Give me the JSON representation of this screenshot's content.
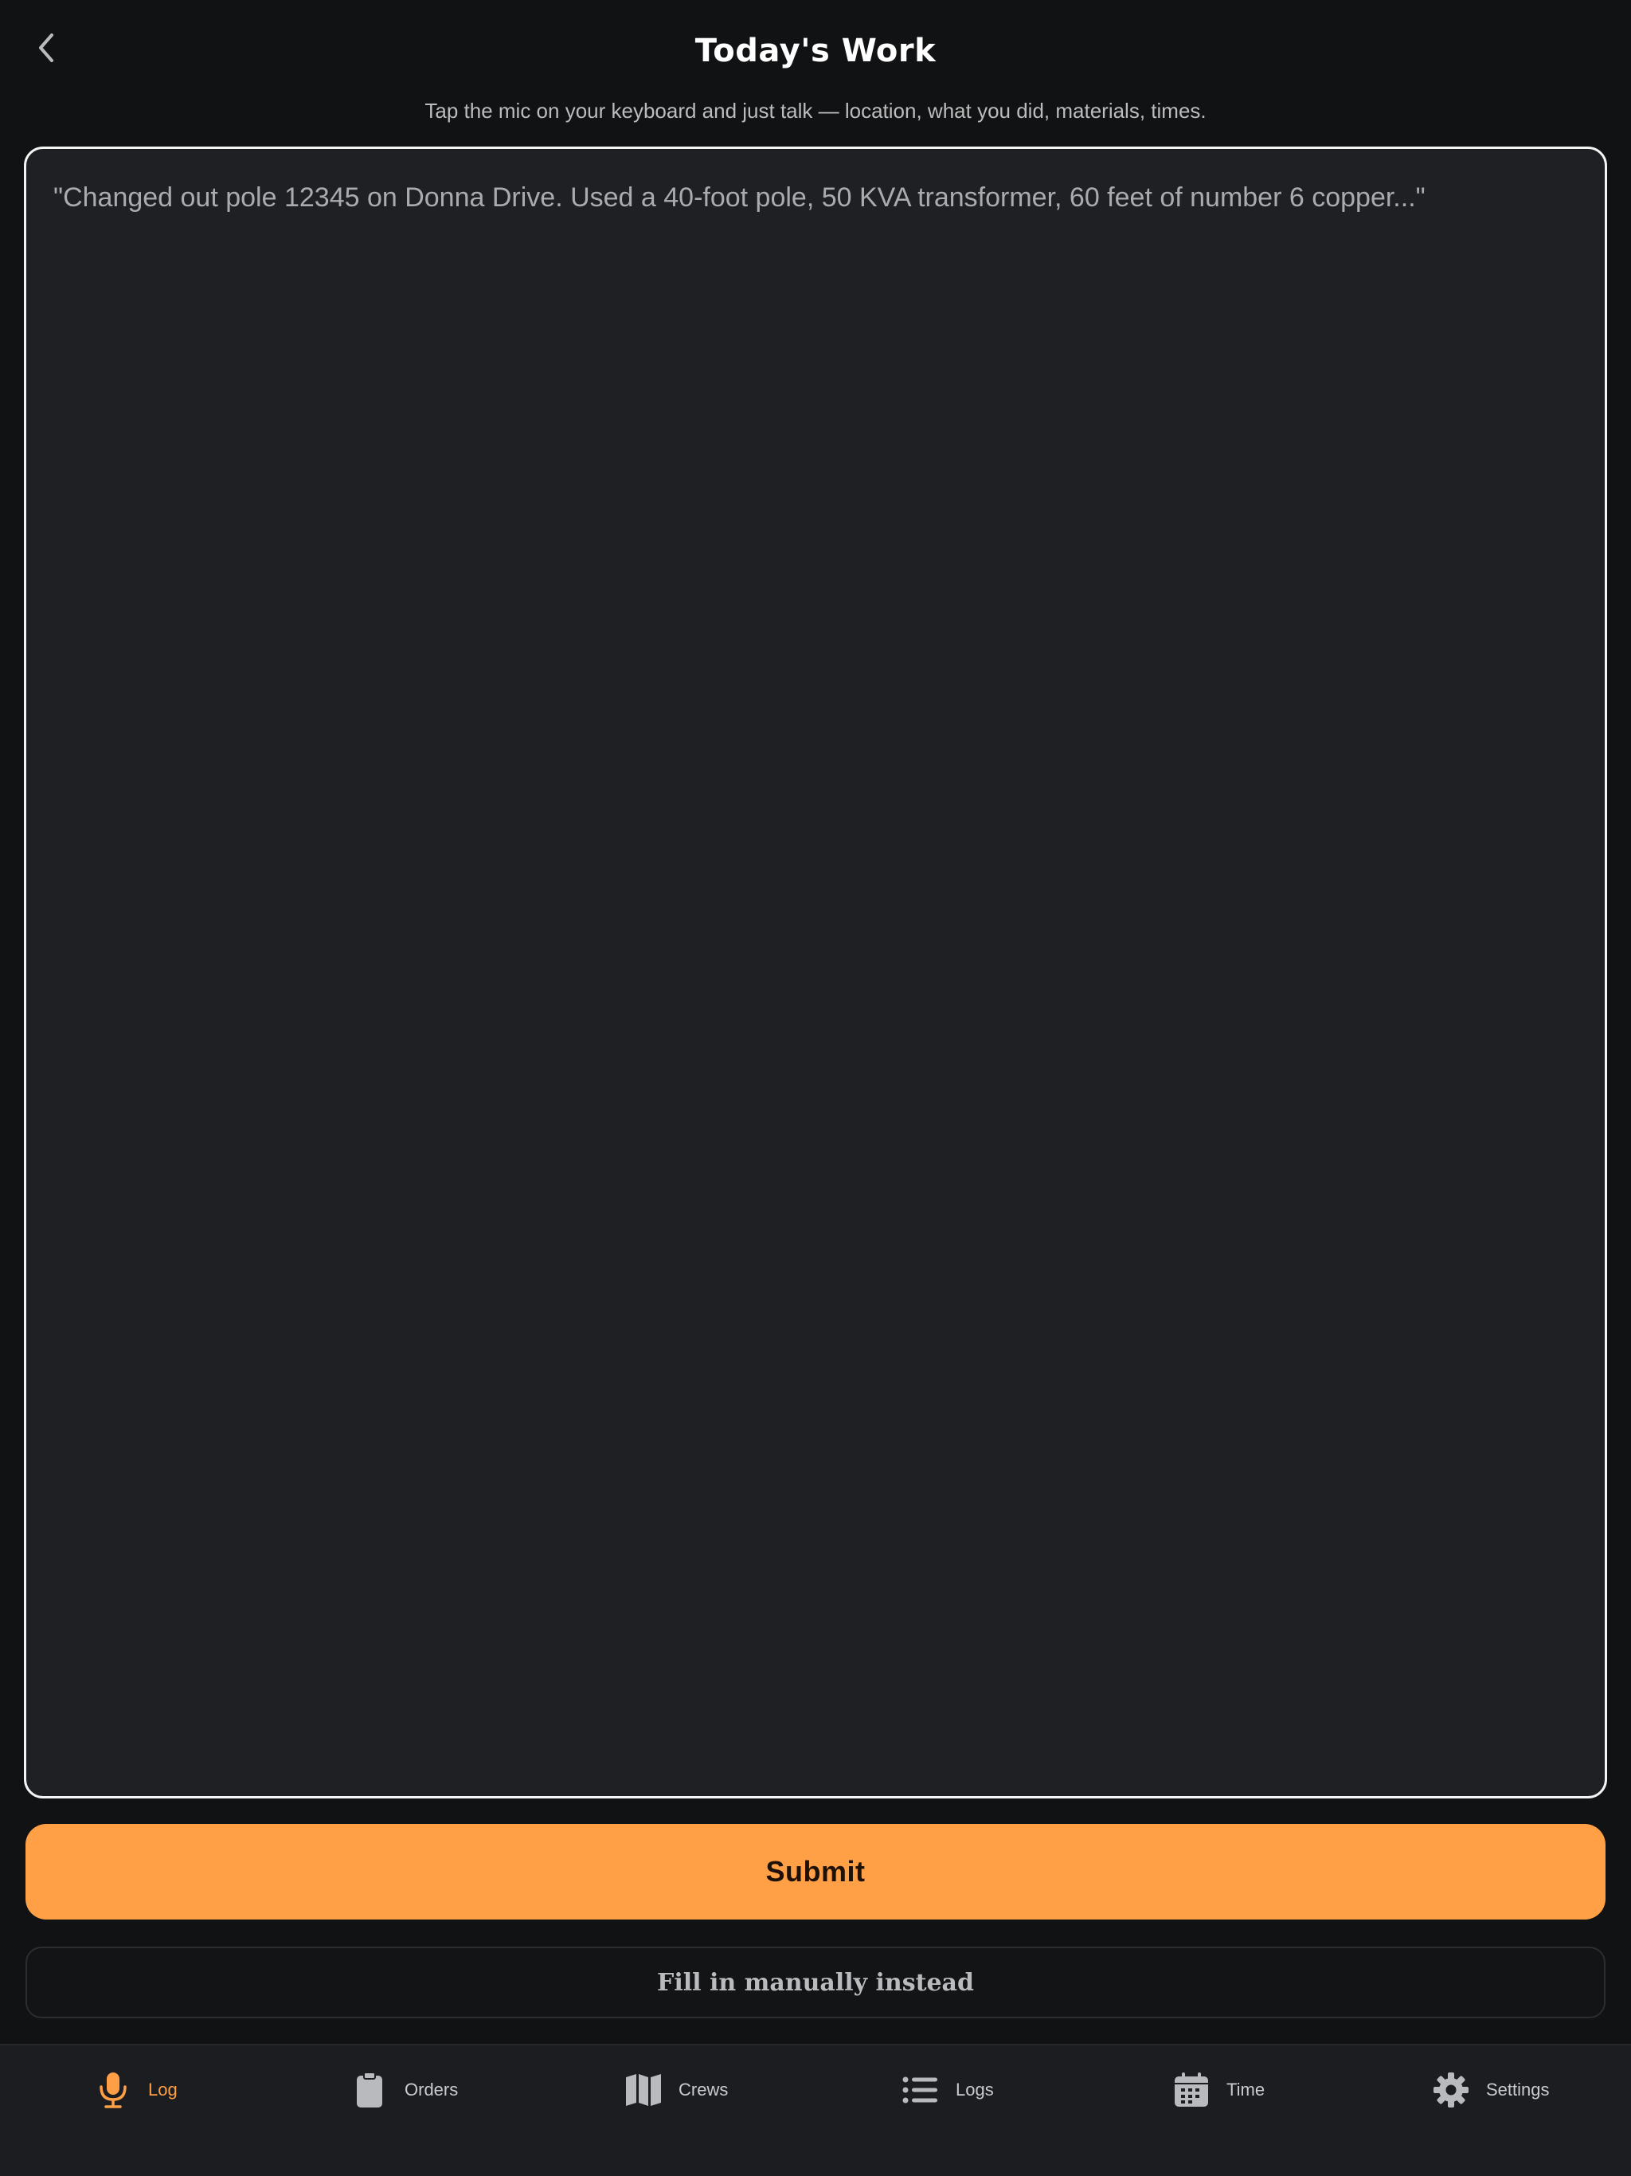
{
  "header": {
    "title": "Today's Work",
    "subtitle": "Tap the mic on your keyboard and just talk — location, what you did, materials, times."
  },
  "work_input": {
    "value": "",
    "placeholder": "\"Changed out pole 12345 on Donna Drive. Used a 40-foot pole, 50 KVA transformer, 60 feet of number 6 copper...\""
  },
  "actions": {
    "submit_label": "Submit",
    "manual_label": "Fill in manually instead"
  },
  "tabs": [
    {
      "label": "Log",
      "icon": "mic-icon",
      "active": true
    },
    {
      "label": "Orders",
      "icon": "clipboard-icon",
      "active": false
    },
    {
      "label": "Crews",
      "icon": "map-icon",
      "active": false
    },
    {
      "label": "Logs",
      "icon": "list-icon",
      "active": false
    },
    {
      "label": "Time",
      "icon": "calendar-icon",
      "active": false
    },
    {
      "label": "Settings",
      "icon": "gear-icon",
      "active": false
    }
  ],
  "colors": {
    "background": "#111214",
    "input_background": "#1e2024",
    "accent": "#ffa046",
    "tab_active": "#ff9f45",
    "tab_inactive": "#c9cbce"
  }
}
